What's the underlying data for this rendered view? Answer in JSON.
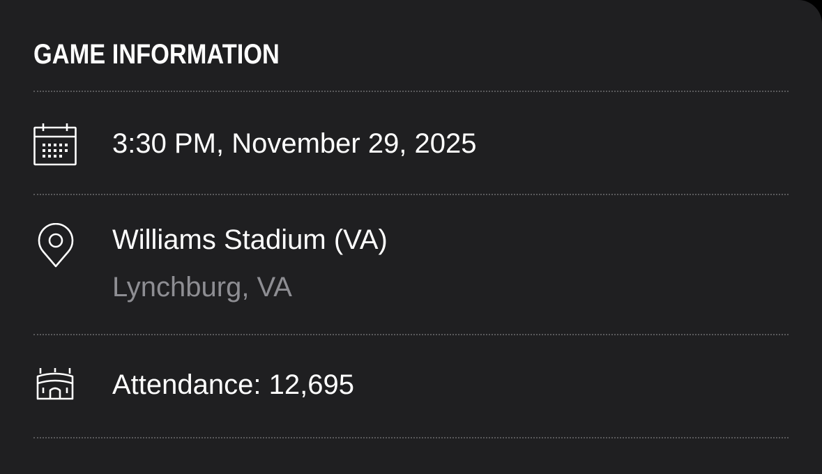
{
  "section": {
    "title": "GAME INFORMATION"
  },
  "rows": {
    "datetime": {
      "icon": "calendar-icon",
      "text": "3:30 PM, November 29, 2025"
    },
    "venue": {
      "icon": "location-pin-icon",
      "name": "Williams Stadium (VA)",
      "location": "Lynchburg, VA"
    },
    "attendance": {
      "icon": "stadium-icon",
      "text": "Attendance: 12,695"
    }
  },
  "colors": {
    "background": "#1f1f21",
    "primary_text": "#ffffff",
    "secondary_text": "#8e8e93",
    "divider": "#5a5a5c"
  }
}
